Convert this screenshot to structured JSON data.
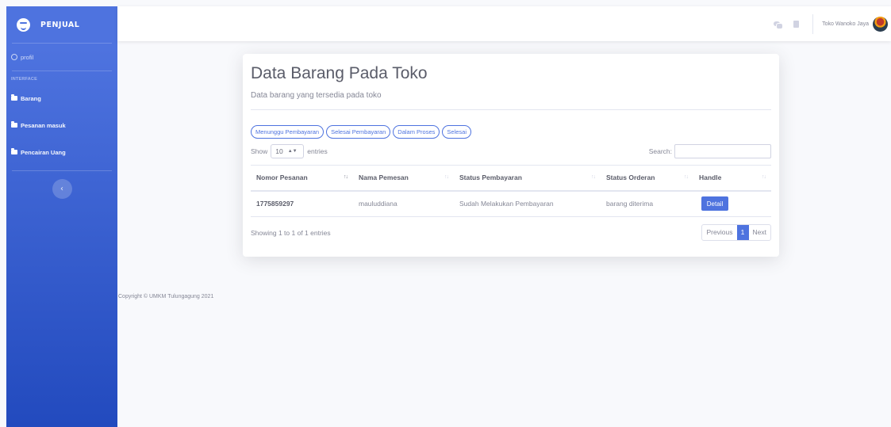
{
  "brand": {
    "name": "PENJUAL"
  },
  "sidebar": {
    "profile_label": "profil",
    "heading": "INTERFACE",
    "items": [
      {
        "label": "Barang",
        "icon": "folder-icon"
      },
      {
        "label": "Pesanan masuk",
        "icon": "folder-icon"
      },
      {
        "label": "Pencairan Uang",
        "icon": "folder-icon"
      }
    ],
    "toggle_icon": "‹"
  },
  "topbar": {
    "user_name": "Toko Wanoko Jaya"
  },
  "main": {
    "title": "Data Barang Pada Toko",
    "subtitle": "Data barang yang tersedia pada toko",
    "filters": [
      "Menunggu Pembayaran",
      "Selesai Pembayaran",
      "Dalam Proses",
      "Selesai"
    ],
    "length": {
      "prefix": "Show",
      "value": "10",
      "suffix": "entries"
    },
    "search_label": "Search:",
    "columns": [
      "Nomor Pesanan",
      "Nama Pemesan",
      "Status Pembayaran",
      "Status Orderan",
      "Handle"
    ],
    "rows": [
      {
        "nomor": "1775859297",
        "nama": "mauluddiana",
        "status_pembayaran": "Sudah Melakukan Pembayaran",
        "status_orderan": "barang diterima",
        "action": "Detail"
      }
    ],
    "info": "Showing 1 to 1 of 1 entries",
    "pagination": {
      "previous": "Previous",
      "current": "1",
      "next": "Next"
    }
  },
  "footer": {
    "copyright": "Copyright © UMKM Tulungagung 2021"
  },
  "colors": {
    "primary": "#4e73df",
    "sidebar_gradient_end": "#224abe",
    "background": "#f8f9fc"
  }
}
